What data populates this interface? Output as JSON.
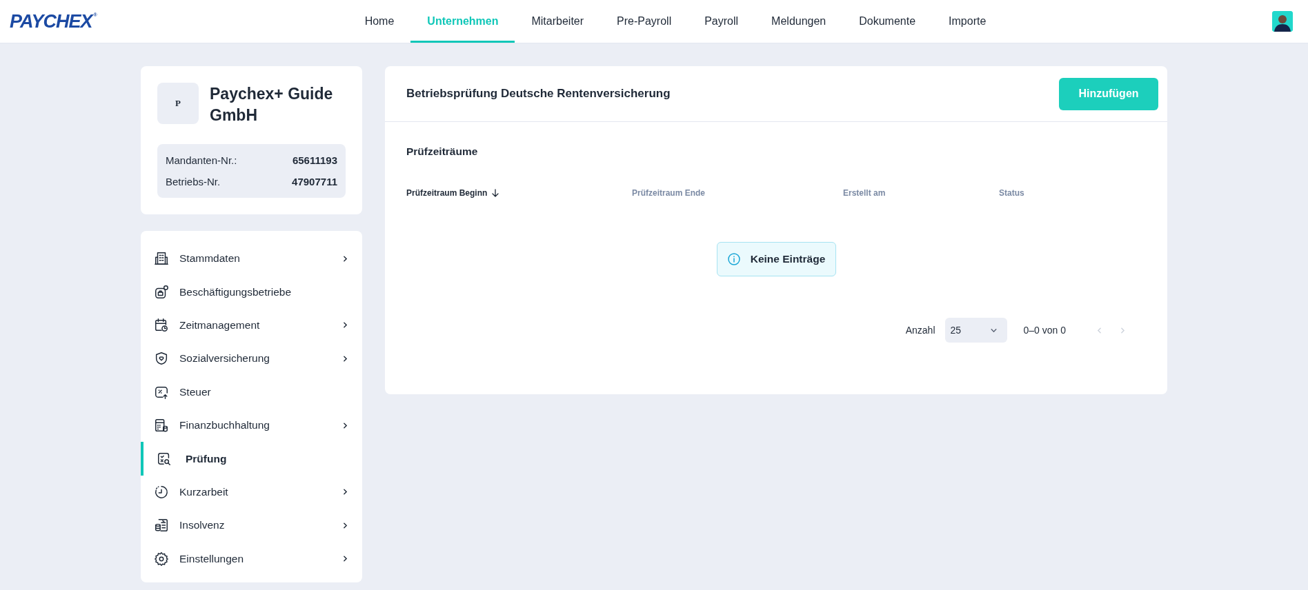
{
  "header": {
    "logo": "PAYCHEX",
    "logo_mark": "®",
    "nav": [
      {
        "label": "Home",
        "selected": false
      },
      {
        "label": "Unternehmen",
        "selected": true
      },
      {
        "label": "Mitarbeiter",
        "selected": false
      },
      {
        "label": "Pre-Payroll",
        "selected": false
      },
      {
        "label": "Payroll",
        "selected": false
      },
      {
        "label": "Meldungen",
        "selected": false
      },
      {
        "label": "Dokumente",
        "selected": false
      },
      {
        "label": "Importe",
        "selected": false
      }
    ]
  },
  "company": {
    "initial": "P",
    "name": "Paychex+ Guide GmbH",
    "facts": [
      {
        "label": "Mandanten-Nr.:",
        "value": "65611193"
      },
      {
        "label": "Betriebs-Nr.",
        "value": "47907711"
      }
    ]
  },
  "sidebar": {
    "items": [
      {
        "label": "Stammdaten",
        "has_submenu": true,
        "selected": false
      },
      {
        "label": "Beschäftigungsbetriebe",
        "has_submenu": false,
        "selected": false
      },
      {
        "label": "Zeitmanagement",
        "has_submenu": true,
        "selected": false
      },
      {
        "label": "Sozialversicherung",
        "has_submenu": true,
        "selected": false
      },
      {
        "label": "Steuer",
        "has_submenu": false,
        "selected": false
      },
      {
        "label": "Finanzbuchhaltung",
        "has_submenu": true,
        "selected": false
      },
      {
        "label": "Prüfung",
        "has_submenu": false,
        "selected": true
      },
      {
        "label": "Kurzarbeit",
        "has_submenu": true,
        "selected": false
      },
      {
        "label": "Insolvenz",
        "has_submenu": true,
        "selected": false
      },
      {
        "label": "Einstellungen",
        "has_submenu": true,
        "selected": false
      }
    ]
  },
  "panel": {
    "title": "Betriebsprüfung Deutsche Rentenversicherung",
    "add_button": "Hinzufügen",
    "section_title": "Prüfzeiträume",
    "table": {
      "columns": [
        {
          "label": "Prüfzeitraum Beginn",
          "sorted": true
        },
        {
          "label": "Prüfzeitraum Ende",
          "sorted": false
        },
        {
          "label": "Erstellt am",
          "sorted": false
        },
        {
          "label": "Status",
          "sorted": false
        }
      ],
      "empty_message": "Keine Einträge"
    },
    "pagination": {
      "page_size_label": "Anzahl",
      "page_size": "25",
      "range": "0–0 von 0",
      "prev_disabled": true,
      "next_disabled": true
    }
  }
}
